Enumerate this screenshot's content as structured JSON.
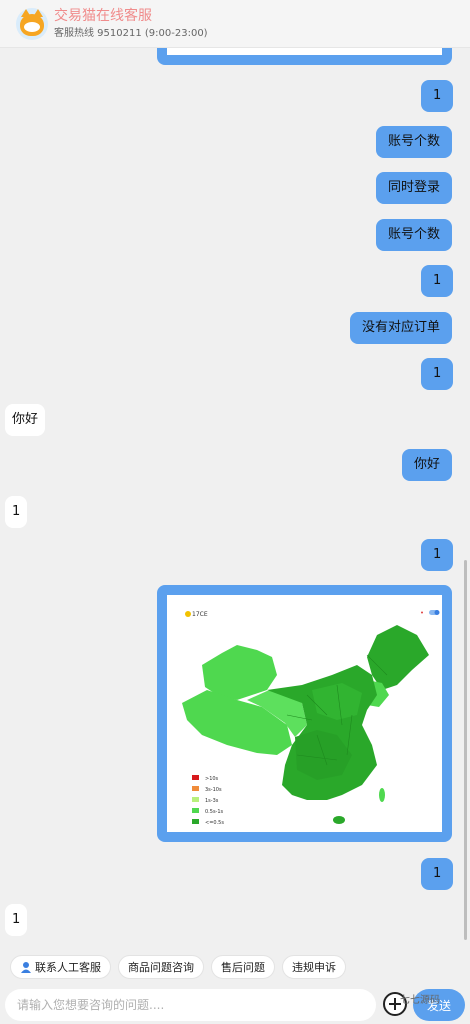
{
  "header": {
    "title": "交易猫在线客服",
    "hotline": "客服热线 9510211 (9:00-23:00)"
  },
  "messages": [
    {
      "side": "right",
      "text": "1"
    },
    {
      "side": "right",
      "text": "账号个数"
    },
    {
      "side": "right",
      "text": "同时登录"
    },
    {
      "side": "right",
      "text": "账号个数"
    },
    {
      "side": "right",
      "text": "1"
    },
    {
      "side": "right",
      "text": "没有对应订单"
    },
    {
      "side": "right",
      "text": "1"
    },
    {
      "side": "left",
      "text": "你好"
    },
    {
      "side": "right",
      "text": "你好"
    },
    {
      "side": "left",
      "text": "1"
    },
    {
      "side": "right",
      "text": "1"
    },
    {
      "side": "right",
      "text": "1"
    },
    {
      "side": "left",
      "text": "1"
    }
  ],
  "map_image": {
    "logo": "17CE",
    "legend": [
      ">10s",
      "3s-10s",
      "1s-3s",
      "0.5s-1s",
      "<=0.5s"
    ],
    "legend_colors": [
      "#d7191c",
      "#f08c3a",
      "#b8f07c",
      "#4fd84f",
      "#2aa82a"
    ]
  },
  "quick_replies": {
    "human": "联系人工客服",
    "goods": "商品问题咨询",
    "after_sale": "售后问题",
    "violation": "违规申诉"
  },
  "input": {
    "placeholder": "请输入您想要咨询的问题....",
    "send_label": "发送"
  },
  "watermark": "七七源码"
}
